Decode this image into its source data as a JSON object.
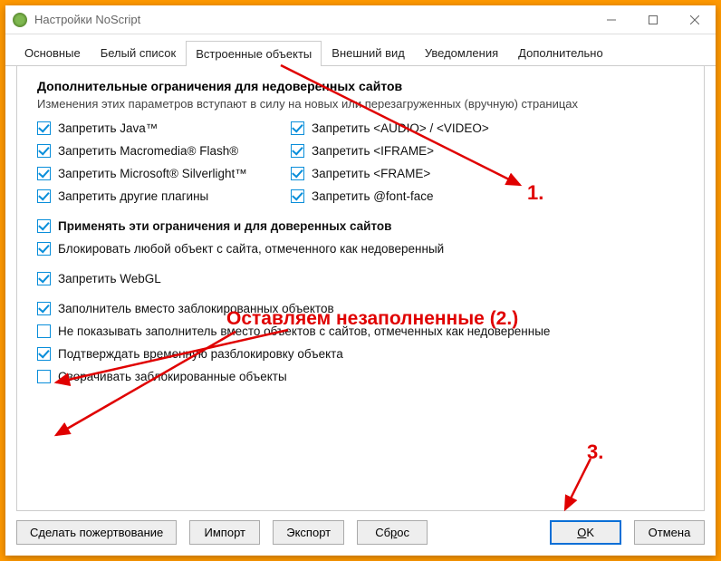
{
  "titlebar": {
    "title": "Настройки NoScript"
  },
  "tabs": {
    "items": [
      {
        "label": "Основные"
      },
      {
        "label": "Белый список"
      },
      {
        "label": "Встроенные объекты"
      },
      {
        "label": "Внешний вид"
      },
      {
        "label": "Уведомления"
      },
      {
        "label": "Дополнительно"
      }
    ],
    "activeIndex": 2
  },
  "section": {
    "title": "Дополнительные ограничения для недоверенных сайтов",
    "subtitle": "Изменения этих параметров вступают в силу на новых или перезагруженных (вручную) страницах"
  },
  "gridLeft": [
    {
      "label": "Запретить Java™",
      "checked": true
    },
    {
      "label": "Запретить Macromedia® Flash®",
      "checked": true
    },
    {
      "label": "Запретить Microsoft® Silverlight™",
      "checked": true
    },
    {
      "label": "Запретить другие плагины",
      "checked": true
    }
  ],
  "gridRight": [
    {
      "label": "Запретить <AUDIO> / <VIDEO>",
      "checked": true
    },
    {
      "label": "Запретить <IFRAME>",
      "checked": true
    },
    {
      "label": "Запретить <FRAME>",
      "checked": true
    },
    {
      "label": "Запретить @font-face",
      "checked": true
    }
  ],
  "fullList": [
    {
      "label": "Применять эти ограничения и для доверенных сайтов",
      "checked": true,
      "bold": true
    },
    {
      "label": "Блокировать любой объект с сайта, отмеченного как недоверенный",
      "checked": true
    },
    {
      "label": "Запретить WebGL",
      "checked": true
    },
    {
      "label": "Заполнитель вместо заблокированных объектов",
      "checked": true
    },
    {
      "label": "Не показывать заполнитель вместо объектов с сайтов, отмеченных как недоверенные",
      "checked": false
    },
    {
      "label": "Подтверждать временную разблокировку объекта",
      "checked": true
    },
    {
      "label": "Сворачивать заблокированные объекты",
      "checked": false
    }
  ],
  "footer": {
    "donate": "Сделать пожертвование",
    "import": "Импорт",
    "export": "Экспорт",
    "reset_pre": "Сб",
    "reset_u": "р",
    "reset_post": "ос",
    "ok_u": "O",
    "ok_post": "K",
    "cancel": "Отмена"
  },
  "annotations": {
    "one": "1.",
    "two": "Оставляем незаполненные (2.)",
    "three": "3."
  }
}
